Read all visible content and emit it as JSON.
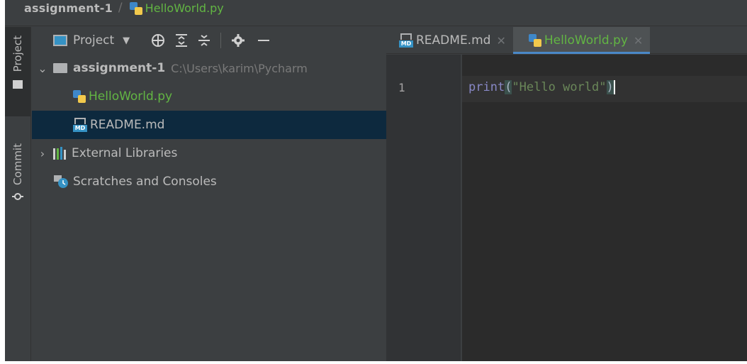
{
  "breadcrumb": {
    "root": "assignment-1",
    "separator": "/",
    "file": "HelloWorld.py"
  },
  "toolstrip": {
    "project_label": "Project",
    "commit_label": "Commit"
  },
  "project_toolbar": {
    "label": "Project"
  },
  "tree": {
    "root": {
      "name": "assignment-1",
      "path": "C:\\Users\\karim\\Pycharm"
    },
    "items": [
      {
        "name": "HelloWorld.py",
        "icon": "python-file-icon"
      },
      {
        "name": "README.md",
        "icon": "markdown-file-icon"
      },
      {
        "name": "External Libraries",
        "icon": "libraries-icon"
      },
      {
        "name": "Scratches and Consoles",
        "icon": "scratches-icon"
      }
    ]
  },
  "tabs": [
    {
      "label": "README.md",
      "icon": "markdown-file-icon"
    },
    {
      "label": "HelloWorld.py",
      "icon": "python-file-icon"
    }
  ],
  "editor": {
    "line_number": "1",
    "code": {
      "func": "print",
      "open": "(",
      "string": "\"Hello world\"",
      "close": ")"
    }
  },
  "colors": {
    "accent": "#4a88c7",
    "selection": "#0d293e",
    "py_file_text": "#62b543",
    "panel_bg": "#3c3f41",
    "editor_bg": "#2b2b2b"
  }
}
